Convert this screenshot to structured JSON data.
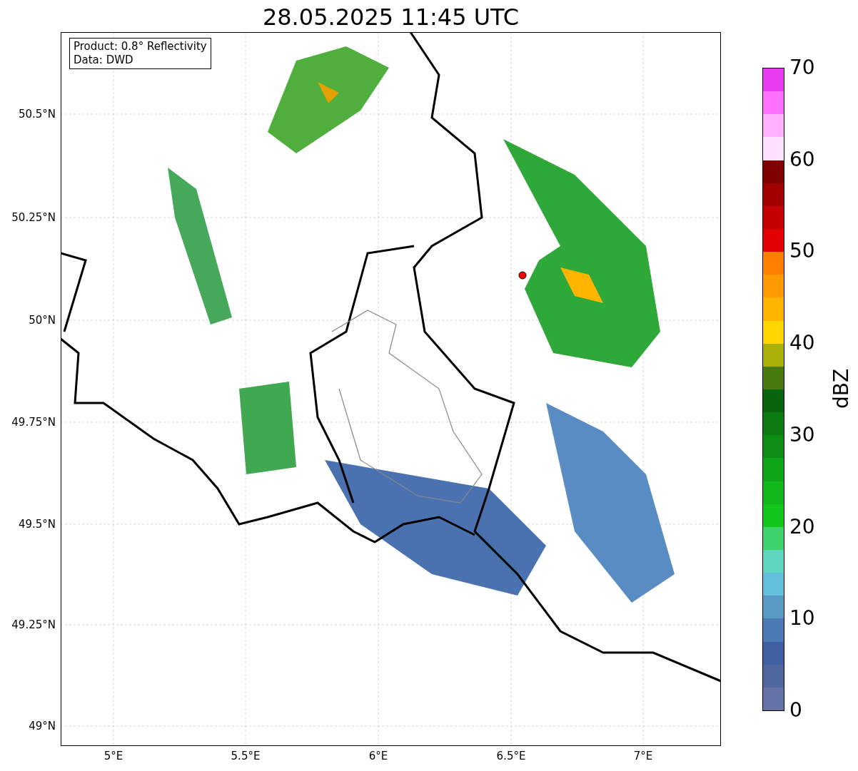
{
  "title": "28.05.2025 11:45 UTC",
  "legend": {
    "lines": [
      "Product: 0.8° Reflectivity",
      "Data: DWD"
    ]
  },
  "y_axis": {
    "ticks": [
      "50.5°N",
      "50.25°N",
      "50°N",
      "49.75°N",
      "49.5°N",
      "49.25°N",
      "49°N"
    ]
  },
  "x_axis": {
    "ticks": [
      "5°E",
      "5.5°E",
      "6°E",
      "6.5°E",
      "7°E"
    ]
  },
  "colorbar": {
    "label": "dBZ",
    "ticks": [
      "70",
      "60",
      "50",
      "40",
      "30",
      "20",
      "10",
      "0"
    ],
    "segments": [
      {
        "color": "#6472a6"
      },
      {
        "color": "#50669f"
      },
      {
        "color": "#405fa3"
      },
      {
        "color": "#4a7ab3"
      },
      {
        "color": "#589ac4"
      },
      {
        "color": "#62c0dc"
      },
      {
        "color": "#5ed6c0"
      },
      {
        "color": "#3dd26c"
      },
      {
        "color": "#12c61c"
      },
      {
        "color": "#10b81a"
      },
      {
        "color": "#0fa518"
      },
      {
        "color": "#0e8d14"
      },
      {
        "color": "#0c7c12"
      },
      {
        "color": "#0a660e"
      },
      {
        "color": "#487a10"
      },
      {
        "color": "#aab108"
      },
      {
        "color": "#ffd700"
      },
      {
        "color": "#ffb500"
      },
      {
        "color": "#ff9a00"
      },
      {
        "color": "#ff7f00"
      },
      {
        "color": "#e30000"
      },
      {
        "color": "#c40000"
      },
      {
        "color": "#a00000"
      },
      {
        "color": "#7f0000"
      },
      {
        "color": "#ffe0ff"
      },
      {
        "color": "#ffb0ff"
      },
      {
        "color": "#ff70ff"
      },
      {
        "color": "#e93cf0"
      }
    ]
  }
}
